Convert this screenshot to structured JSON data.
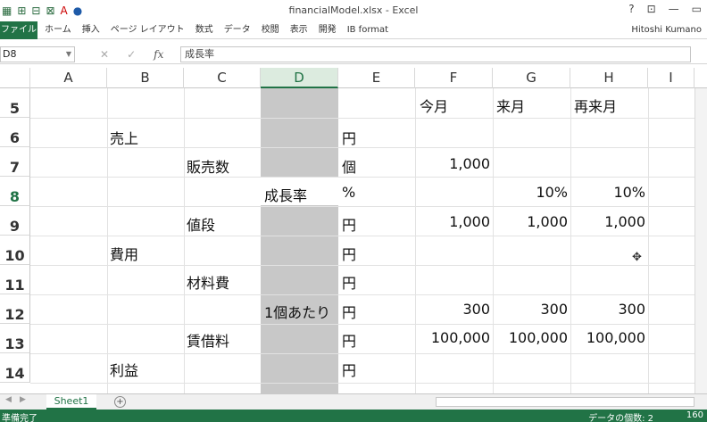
{
  "window": {
    "title": "financialModel.xlsx - Excel",
    "controls": [
      "?",
      "⊡",
      "—",
      "▭"
    ]
  },
  "ribbon": {
    "file_label": "ファイル",
    "tabs": [
      "ホーム",
      "挿入",
      "ページ レイアウト",
      "数式",
      "データ",
      "校閲",
      "表示",
      "開発",
      "IB format"
    ],
    "user_name": "Hitoshi Kumano"
  },
  "formula_bar": {
    "name_box": "D8",
    "formula": "成長率",
    "cancel_glyph": "✕",
    "enter_glyph": "✓",
    "fx_glyph": "fx"
  },
  "columns": [
    "A",
    "B",
    "C",
    "D",
    "E",
    "F",
    "G",
    "H",
    "I"
  ],
  "selected_column": "D",
  "rows": [
    "5",
    "6",
    "7",
    "8",
    "9",
    "10",
    "11",
    "12",
    "13",
    "14"
  ],
  "selected_row": "8",
  "cells": {
    "F5": "今月",
    "G5": "来月",
    "H5": "再来月",
    "B6": "売上",
    "E6": "円",
    "C7": "販売数",
    "E7": "個",
    "F7": "1,000",
    "D8": "成長率",
    "E8": "%",
    "G8": "10%",
    "H8": "10%",
    "C9": "値段",
    "E9": "円",
    "F9": "1,000",
    "G9": "1,000",
    "H9": "1,000",
    "B10": "費用",
    "E10": "円",
    "C11": "材料費",
    "E11": "円",
    "D12": "1個あたり",
    "E12": "円",
    "F12": "300",
    "G12": "300",
    "H12": "300",
    "C13": "賃借料",
    "E13": "円",
    "F13": "100,000",
    "G13": "100,000",
    "H13": "100,000",
    "B14": "利益",
    "E14": "円"
  },
  "sheets": [
    "Sheet1"
  ],
  "add_sheet_glyph": "+",
  "status": {
    "ready": "準備完了",
    "count": "データの個数: 2",
    "zoom": "160"
  },
  "colors": {
    "excel_green": "#217346",
    "selected_column_fill": "#c8c8c8"
  }
}
